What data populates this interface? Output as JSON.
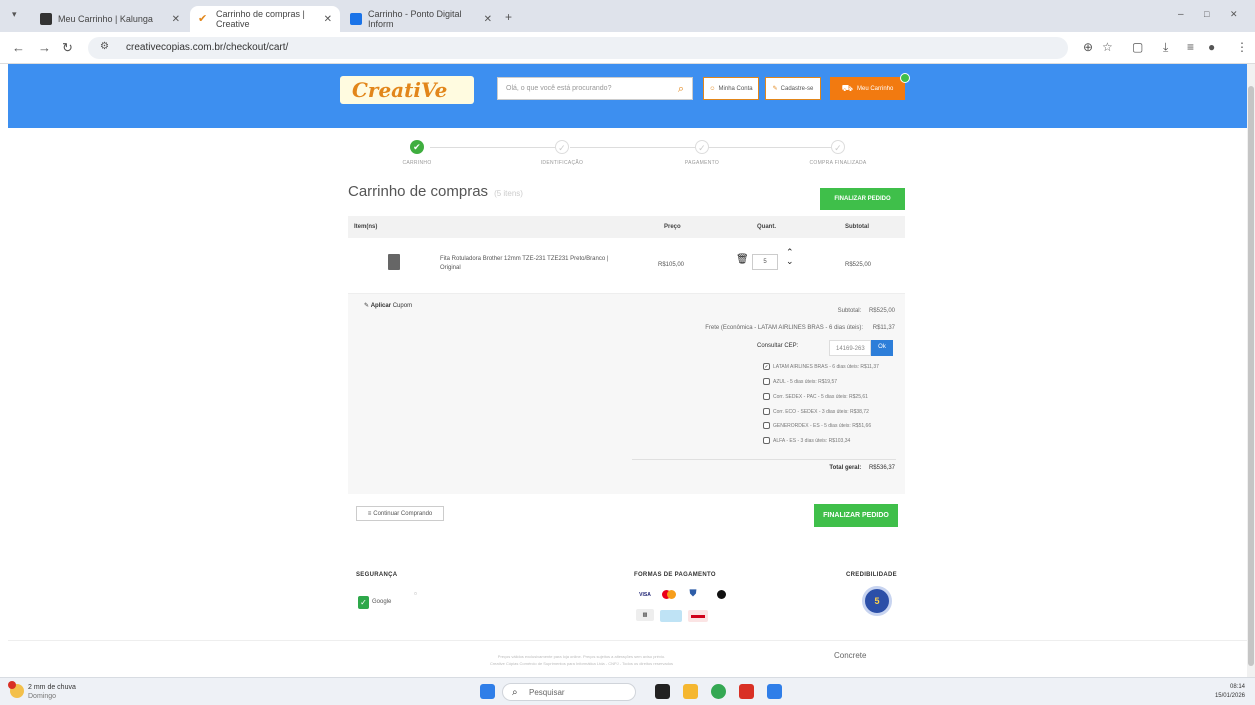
{
  "browser": {
    "tabs": [
      {
        "title": "Meu Carrinho | Kalunga"
      },
      {
        "title": "Carrinho de compras | Creative"
      },
      {
        "title": "Carrinho - Ponto Digital Inform"
      }
    ],
    "url": "creativecopias.com.br/checkout/cart/"
  },
  "header": {
    "logo_text": "CreatiVe",
    "search_placeholder": "Olá, o que você está procurando?",
    "my_account": "Minha Conta",
    "register": "Cadastre-se",
    "my_cart": "Meu Carrinho"
  },
  "steps": [
    {
      "label": "CARRINHO",
      "done": true
    },
    {
      "label": "IDENTIFICAÇÃO",
      "done": false
    },
    {
      "label": "PAGAMENTO",
      "done": false
    },
    {
      "label": "COMPRA FINALIZADA",
      "done": false
    }
  ],
  "cart": {
    "title": "Carrinho de compras",
    "count": "(5 itens)",
    "finalize_label": "FINALIZAR PEDIDO",
    "columns": {
      "item": "Item(ns)",
      "price": "Preço",
      "qty": "Quant.",
      "subtotal": "Subtotal"
    },
    "items": [
      {
        "name": "Fita Rotuladora Brother 12mm TZE-231 TZE231 Preto/Branco | Original",
        "price": "R$105,00",
        "qty": "5",
        "subtotal": "R$525,00"
      }
    ]
  },
  "summary": {
    "coupon_bold": "Aplicar",
    "coupon_rest": "Cupom",
    "subtotal_label": "Subtotal:",
    "subtotal_value": "R$525,00",
    "shipping_label": "Frete (Econômica - LATAM AIRLINES BRAS - 6 dias úteis):",
    "shipping_value": "R$11,37",
    "cep_label": "Consultar CEP:",
    "cep_value": "14169-263",
    "cep_ok": "Ok",
    "options": [
      {
        "text": "LATAM AIRLINES BRAS - 6 dias úteis: R$11,37",
        "selected": true
      },
      {
        "text": "AZUL - 5 dias úteis: R$19,57",
        "selected": false
      },
      {
        "text": "Corr. SEDEX - PAC - 5 dias úteis: R$25,61",
        "selected": false
      },
      {
        "text": "Corr. ECO - SEDEX - 3 dias úteis: R$38,72",
        "selected": false
      },
      {
        "text": "GENERORDEX - ES - 5 dias úteis: R$51,66",
        "selected": false
      },
      {
        "text": "ALFA - ES - 3 dias úteis: R$103,34",
        "selected": false
      }
    ],
    "total_label": "Total geral:",
    "total_value": "R$536,37"
  },
  "continue_label": "Continuar Comprando",
  "footer": {
    "security": "SEGURANÇA",
    "payment": "FORMAS DE PAGAMENTO",
    "credibility": "CREDIBILIDADE",
    "safe_text": "Google",
    "visa": "VISA",
    "note1": "Preços válidos exclusivamente para loja online. Preços sujeitos a alterações sem aviso prévio.",
    "note2": "Creative Cópias Comércio de Suprimentos para Informática Ltda - CNPJ - Todos os direitos reservados",
    "developer": "Concrete"
  },
  "taskbar": {
    "weather": "2 mm de chuva",
    "weather_sub": "Domingo",
    "search": "Pesquisar",
    "time": "08:14",
    "date": "15/01/2026"
  }
}
